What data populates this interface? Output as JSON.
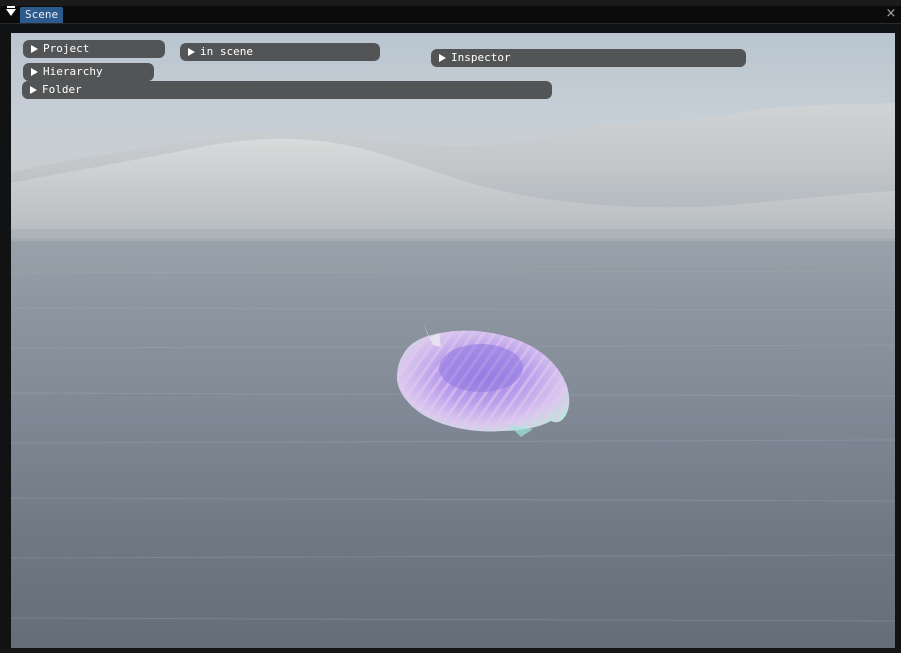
{
  "window": {
    "tab_label": "Scene",
    "close_glyph": "×"
  },
  "panels": {
    "project": "Project",
    "in_scene": "in scene",
    "inspector": "Inspector",
    "hierarchy": "Hierarchy",
    "folder": "Folder"
  },
  "icons": {
    "collapse": "collapse-arrow-icon",
    "expand": "expand-triangle-icon",
    "close": "close-icon"
  },
  "colors": {
    "tab_active": "#2d5a8c",
    "panel_header": "#535456",
    "background": "#111214"
  }
}
